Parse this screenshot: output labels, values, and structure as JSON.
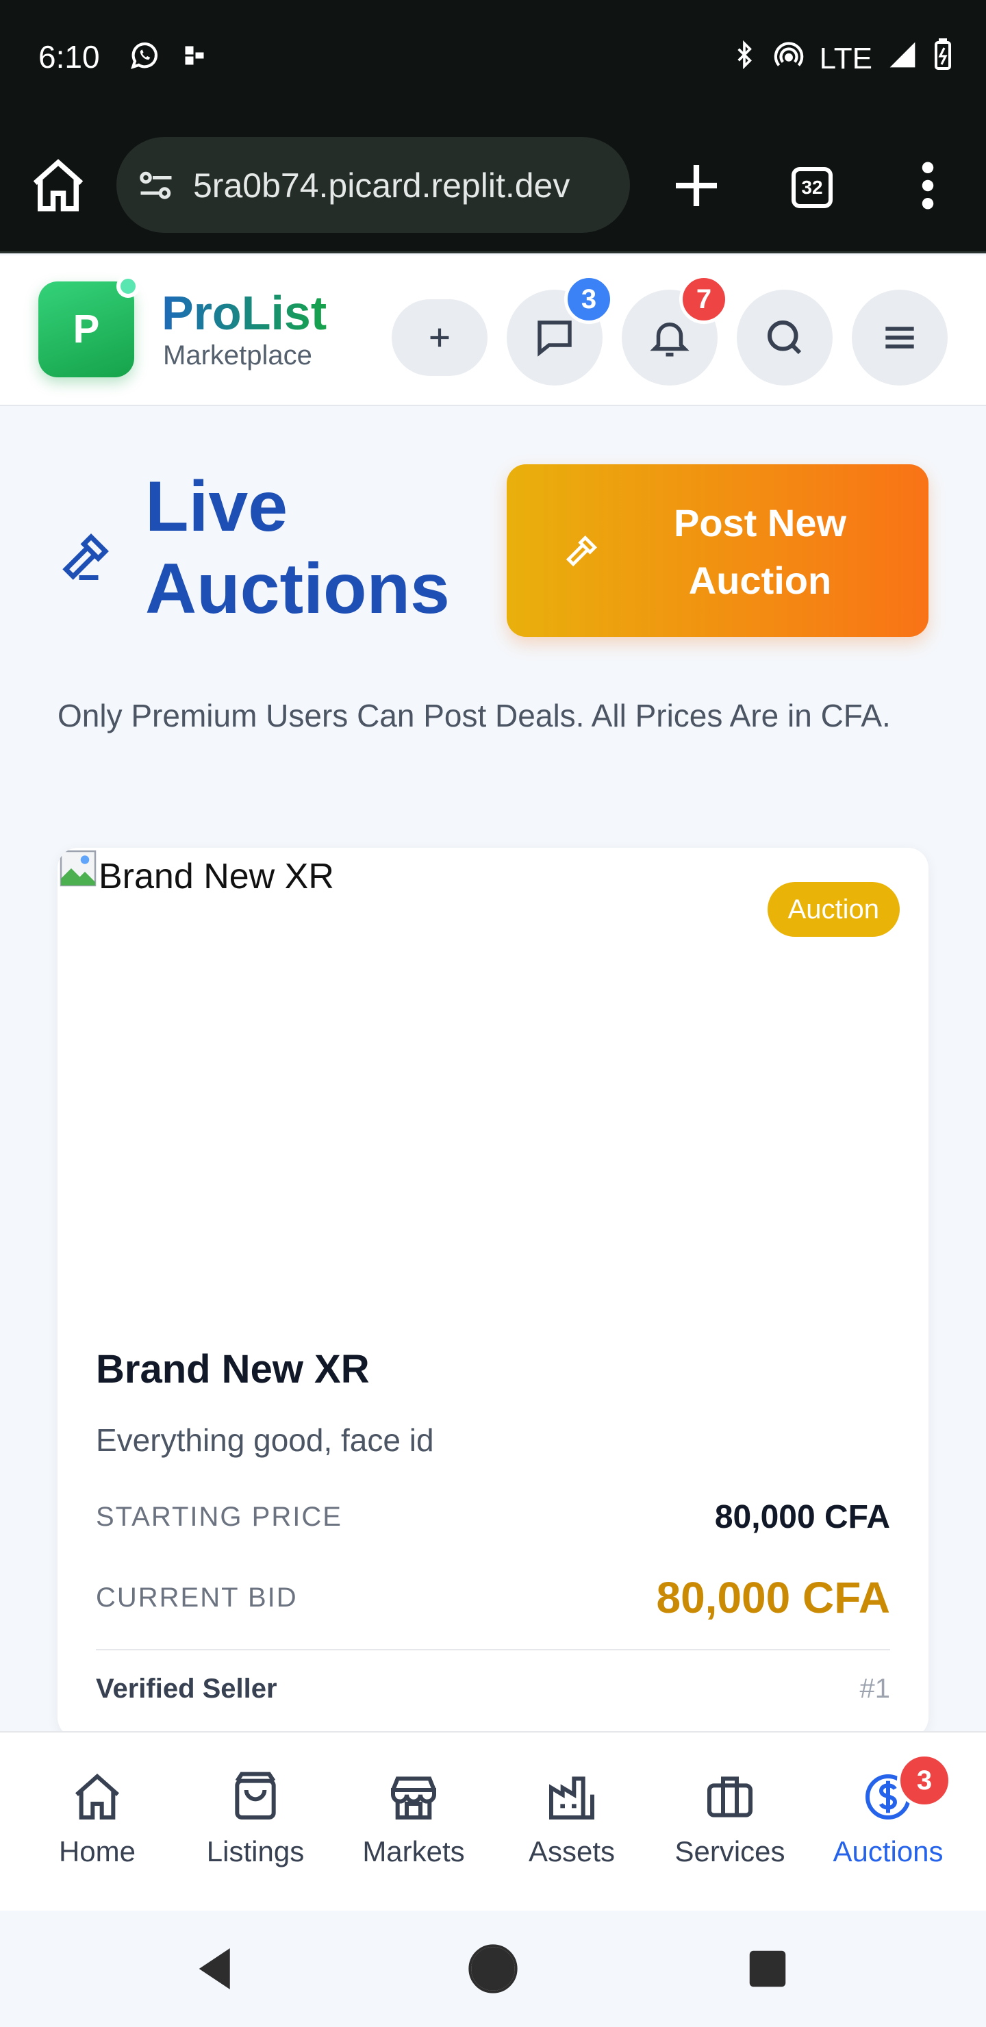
{
  "status_bar": {
    "time": "6:10",
    "network": "LTE"
  },
  "browser": {
    "url": "5ra0b74.picard.replit.dev",
    "tab_count": "32"
  },
  "header": {
    "brand_letter": "P",
    "brand_name": "ProList",
    "brand_subtitle": "Marketplace",
    "messages_badge": "3",
    "notifications_badge": "7"
  },
  "page": {
    "title": "Live Auctions",
    "post_button_label": "Post New Auction",
    "subtitle": "Only Premium Users Can Post Deals. All Prices Are in CFA."
  },
  "auction_card": {
    "image_alt": "Brand New XR",
    "tag": "Auction",
    "title": "Brand New XR",
    "description": "Everything good, face id",
    "starting_price_label": "STARTING PRICE",
    "starting_price": "80,000 CFA",
    "current_bid_label": "CURRENT BID",
    "current_bid": "80,000 CFA",
    "seller": "Verified Seller",
    "lot_number": "#1"
  },
  "bottom_nav": {
    "items": [
      {
        "label": "Home",
        "icon": "home-icon"
      },
      {
        "label": "Listings",
        "icon": "shopping-bag-icon"
      },
      {
        "label": "Markets",
        "icon": "store-icon"
      },
      {
        "label": "Assets",
        "icon": "factory-icon"
      },
      {
        "label": "Services",
        "icon": "briefcase-icon"
      },
      {
        "label": "Auctions",
        "icon": "dollar-circle-icon",
        "badge": "3",
        "active": true
      }
    ]
  },
  "colors": {
    "brand_blue": "#1e4fb5",
    "brand_green": "#16a34a",
    "accent_orange": "#f97316",
    "accent_gold": "#ca8a04",
    "active_nav": "#2563eb",
    "badge_red": "#ef4444"
  }
}
